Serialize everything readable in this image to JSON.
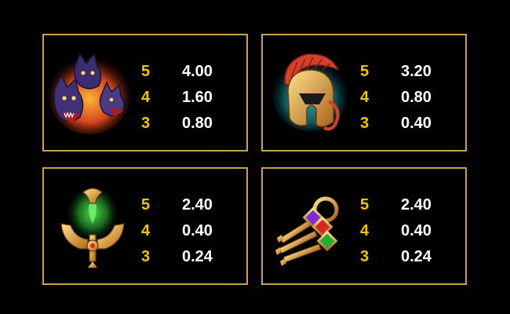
{
  "colors": {
    "background": "#000000",
    "panel_border": "#c9a24a",
    "count_color": "#f5c400",
    "value_color": "#ffffff"
  },
  "paytable": [
    {
      "symbol_icon": "three-headed-dog-icon",
      "rows": [
        {
          "count": "5",
          "payout": "4.00"
        },
        {
          "count": "4",
          "payout": "1.60"
        },
        {
          "count": "3",
          "payout": "0.80"
        }
      ]
    },
    {
      "symbol_icon": "spartan-helmet-icon",
      "rows": [
        {
          "count": "5",
          "payout": "3.20"
        },
        {
          "count": "4",
          "payout": "0.80"
        },
        {
          "count": "3",
          "payout": "0.40"
        }
      ]
    },
    {
      "symbol_icon": "trident-amulet-icon",
      "rows": [
        {
          "count": "5",
          "payout": "2.40"
        },
        {
          "count": "4",
          "payout": "0.40"
        },
        {
          "count": "3",
          "payout": "0.24"
        }
      ]
    },
    {
      "symbol_icon": "key-ring-icon",
      "rows": [
        {
          "count": "5",
          "payout": "2.40"
        },
        {
          "count": "4",
          "payout": "0.40"
        },
        {
          "count": "3",
          "payout": "0.24"
        }
      ]
    }
  ]
}
